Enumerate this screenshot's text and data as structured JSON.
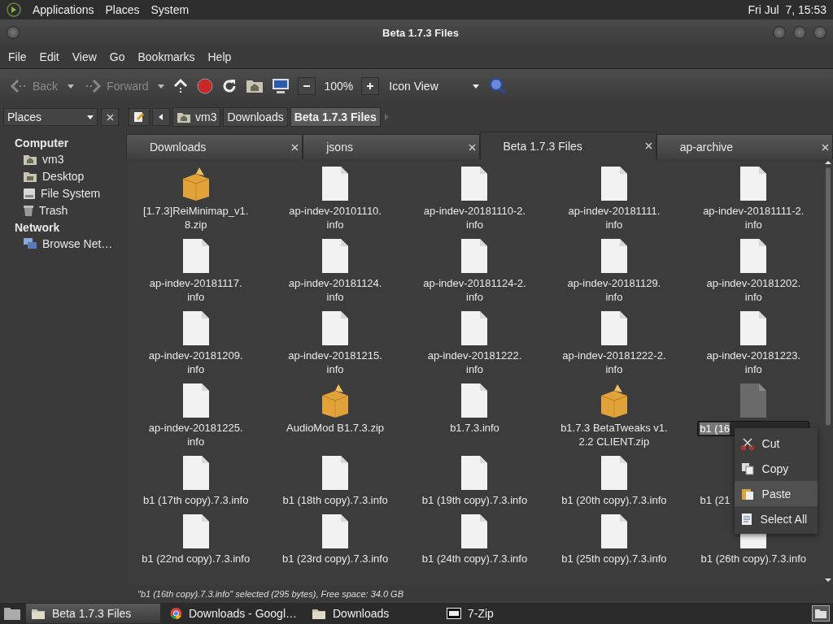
{
  "top_panel": {
    "menus": [
      "Applications",
      "Places",
      "System"
    ],
    "clock": "Fri Jul  7, 15:53"
  },
  "window": {
    "title": "Beta 1.7.3 Files"
  },
  "menubar": [
    "File",
    "Edit",
    "View",
    "Go",
    "Bookmarks",
    "Help"
  ],
  "toolbar": {
    "back": {
      "label": "Back",
      "disabled": true
    },
    "forward": {
      "label": "Forward",
      "disabled": true
    },
    "zoom": "100%",
    "view": "Icon View"
  },
  "sidebar": {
    "selector": "Places",
    "sections": [
      {
        "title": "Computer",
        "children": [
          {
            "label": "vm3",
            "kind": "home"
          },
          {
            "label": "Desktop",
            "kind": "desktop"
          },
          {
            "label": "File System",
            "kind": "drive"
          },
          {
            "label": "Trash",
            "kind": "trash"
          }
        ]
      },
      {
        "title": "Network",
        "children": [
          {
            "label": "Browse Net…",
            "kind": "network"
          }
        ]
      }
    ]
  },
  "path": [
    {
      "label": "vm3",
      "kind": "home",
      "selected": false
    },
    {
      "label": "Downloads",
      "kind": "plain",
      "selected": false
    },
    {
      "label": "Beta 1.7.3 Files",
      "kind": "plain",
      "selected": true
    }
  ],
  "tabs": [
    {
      "label": "Downloads",
      "selected": false
    },
    {
      "label": "jsons",
      "selected": false
    },
    {
      "label": "Beta 1.7.3 Files",
      "selected": true
    },
    {
      "label": "ap-archive",
      "selected": false
    }
  ],
  "files": [
    {
      "kind": "zip",
      "lines": [
        "[1.7.3]ReiMinimap_v1.",
        "8.zip"
      ]
    },
    {
      "kind": "file",
      "lines": [
        "ap-indev-20101110.",
        "info"
      ]
    },
    {
      "kind": "file",
      "lines": [
        "ap-indev-20181110-2.",
        "info"
      ]
    },
    {
      "kind": "file",
      "lines": [
        "ap-indev-20181111.",
        "info"
      ]
    },
    {
      "kind": "file",
      "lines": [
        "ap-indev-20181111-2.",
        "info"
      ]
    },
    {
      "kind": "file",
      "lines": [
        "ap-indev-20181117.",
        "info"
      ]
    },
    {
      "kind": "file",
      "lines": [
        "ap-indev-20181124.",
        "info"
      ]
    },
    {
      "kind": "file",
      "lines": [
        "ap-indev-20181124-2.",
        "info"
      ]
    },
    {
      "kind": "file",
      "lines": [
        "ap-indev-20181129.",
        "info"
      ]
    },
    {
      "kind": "file",
      "lines": [
        "ap-indev-20181202.",
        "info"
      ]
    },
    {
      "kind": "file",
      "lines": [
        "ap-indev-20181209.",
        "info"
      ]
    },
    {
      "kind": "file",
      "lines": [
        "ap-indev-20181215.",
        "info"
      ]
    },
    {
      "kind": "file",
      "lines": [
        "ap-indev-20181222.",
        "info"
      ]
    },
    {
      "kind": "file",
      "lines": [
        "ap-indev-20181222-2.",
        "info"
      ]
    },
    {
      "kind": "file",
      "lines": [
        "ap-indev-20181223.",
        "info"
      ]
    },
    {
      "kind": "file",
      "lines": [
        "ap-indev-20181225.",
        "info"
      ]
    },
    {
      "kind": "zip",
      "lines": [
        "AudioMod B1.7.3.zip"
      ]
    },
    {
      "kind": "file",
      "lines": [
        "b1.7.3.info"
      ]
    },
    {
      "kind": "zip",
      "lines": [
        "b1.7.3 BetaTweaks v1.",
        "2.2 CLIENT.zip"
      ]
    },
    {
      "kind": "rename",
      "lines": [
        "b1 (16"
      ],
      "menu": [
        {
          "label": "Cut",
          "kind": "cut",
          "selected": false
        },
        {
          "label": "Copy",
          "kind": "copy",
          "selected": false
        },
        {
          "label": "Paste",
          "kind": "paste",
          "selected": true
        },
        {
          "label": "Select All",
          "kind": "selectall",
          "selected": false
        }
      ]
    },
    {
      "kind": "file",
      "lines": [
        "b1 (17th copy).7.3.info"
      ]
    },
    {
      "kind": "file",
      "lines": [
        "b1 (18th copy).7.3.info"
      ]
    },
    {
      "kind": "file",
      "lines": [
        "b1 (19th copy).7.3.info"
      ]
    },
    {
      "kind": "file",
      "lines": [
        "b1 (20th copy).7.3.info"
      ]
    },
    {
      "kind": "covered",
      "lines": [
        "b1 (21"
      ]
    },
    {
      "kind": "file",
      "lines": [
        "b1 (22nd copy).7.3.info"
      ]
    },
    {
      "kind": "file",
      "lines": [
        "b1 (23rd copy).7.3.info"
      ]
    },
    {
      "kind": "file",
      "lines": [
        "b1 (24th copy).7.3.info"
      ]
    },
    {
      "kind": "file",
      "lines": [
        "b1 (25th copy).7.3.info"
      ]
    },
    {
      "kind": "file",
      "lines": [
        "b1 (26th copy).7.3.info"
      ]
    }
  ],
  "status_bar": "\"b1 (16th copy).7.3.info\" selected (295 bytes), Free space: 34.0 GB",
  "taskbar": [
    {
      "label": "Beta 1.7.3 Files",
      "kind": "folder",
      "selected": true
    },
    {
      "label": "Downloads - Googl…",
      "kind": "browser",
      "selected": false
    },
    {
      "label": "Downloads",
      "kind": "folder",
      "selected": false
    },
    {
      "label": "7-Zip",
      "kind": "zip",
      "selected": false
    }
  ]
}
